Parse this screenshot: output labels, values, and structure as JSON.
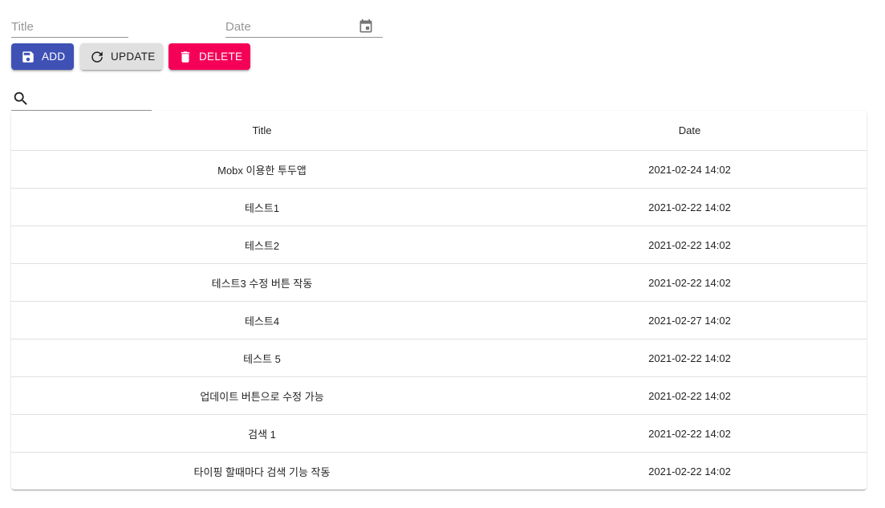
{
  "form": {
    "title_placeholder": "Title",
    "title_value": "",
    "date_placeholder": "Date",
    "date_value": "",
    "calendar_icon": "calendar-icon"
  },
  "buttons": {
    "add_label": "ADD",
    "add_icon": "save-icon",
    "update_label": "UPDATE",
    "update_icon": "refresh-icon",
    "delete_label": "DELETE",
    "delete_icon": "trash-icon"
  },
  "search": {
    "icon": "search-icon",
    "value": ""
  },
  "table": {
    "headers": [
      "Title",
      "Date"
    ],
    "rows": [
      {
        "title": "Mobx 이용한 투두앱",
        "date": "2021-02-24 14:02"
      },
      {
        "title": "테스트1",
        "date": "2021-02-22 14:02"
      },
      {
        "title": "테스트2",
        "date": "2021-02-22 14:02"
      },
      {
        "title": "테스트3 수정 버튼 작동",
        "date": "2021-02-22 14:02"
      },
      {
        "title": "테스트4",
        "date": "2021-02-27 14:02"
      },
      {
        "title": "테스트 5",
        "date": "2021-02-22 14:02"
      },
      {
        "title": "업데이트 버튼으로 수정 가능",
        "date": "2021-02-22 14:02"
      },
      {
        "title": "검색 1",
        "date": "2021-02-22 14:02"
      },
      {
        "title": "타이핑 할때마다 검색 기능 작동",
        "date": "2021-02-22 14:02"
      }
    ]
  },
  "colors": {
    "primary": "#3f51b5",
    "secondary": "#f50057",
    "default_button": "#e0e0e0"
  }
}
